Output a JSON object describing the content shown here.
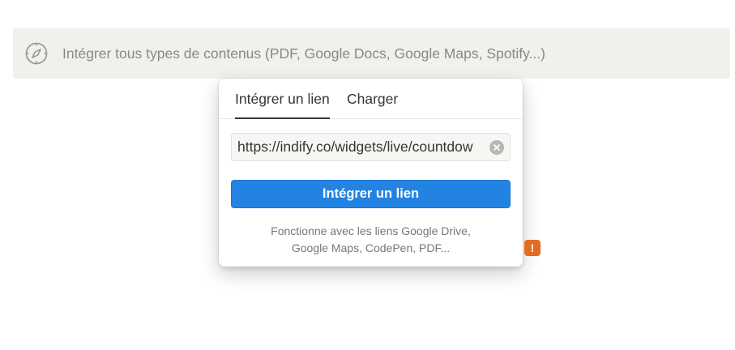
{
  "embed_bar": {
    "icon": "compass-icon",
    "placeholder": "Intégrer tous types de contenus (PDF, Google Docs, Google Maps, Spotify...)"
  },
  "popover": {
    "tabs": [
      {
        "label": "Intégrer un lien",
        "active": true
      },
      {
        "label": "Charger",
        "active": false
      }
    ],
    "url_input": {
      "value": "https://indify.co/widgets/live/countdow"
    },
    "clear_icon": "clear-circle-icon",
    "submit_label": "Intégrer un lien",
    "hint_lines": [
      "Fonctionne avec les liens Google Drive,",
      "Google Maps, CodePen, PDF..."
    ]
  },
  "warning_badge": {
    "label": "!",
    "color": "#e36b22"
  },
  "colors": {
    "accent": "#2383e2",
    "bar_background": "#f1f0ed",
    "text": "#37352f"
  }
}
